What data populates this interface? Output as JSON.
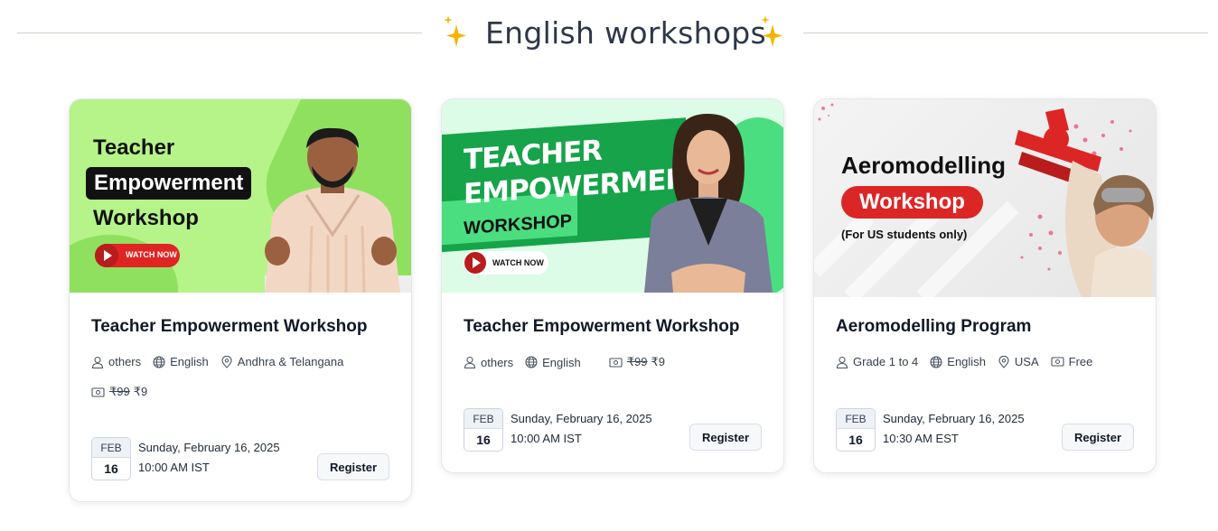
{
  "section": {
    "title": "English workshops"
  },
  "colors": {
    "accent": "#f5b400",
    "thumb1_bg": "#b9f58c",
    "thumb2_bg": "#dcfce7",
    "thumb2_band": "#16a34a",
    "thumb3_accent": "#dc2626"
  },
  "cards": [
    {
      "thumb": {
        "line1": "Teacher",
        "line2": "Empowerment",
        "line3": "Workshop",
        "cta": "WATCH NOW"
      },
      "title": "Teacher Empowerment Workshop",
      "audience": "others",
      "language": "English",
      "location": "Andhra & Telangana",
      "price_old": "₹99",
      "price_new": "₹9",
      "month": "FEB",
      "day": "16",
      "date": "Sunday, February 16, 2025",
      "time": "10:00 AM IST",
      "button": "Register"
    },
    {
      "thumb": {
        "line1": "TEACHER",
        "line2": "EMPOWERMENT",
        "line3": "WORKSHOP",
        "cta": "WATCH NOW"
      },
      "title": "Teacher Empowerment Workshop",
      "audience": "others",
      "language": "English",
      "price_old": "₹99",
      "price_new": "₹9",
      "month": "FEB",
      "day": "16",
      "date": "Sunday, February 16, 2025",
      "time": "10:00 AM IST",
      "button": "Register"
    },
    {
      "thumb": {
        "line1": "Aeromodelling",
        "line2": "Workshop",
        "line3": "(For US students only)"
      },
      "title": "Aeromodelling Program",
      "audience": "Grade 1 to 4",
      "language": "English",
      "location": "USA",
      "price": "Free",
      "month": "FEB",
      "day": "16",
      "date": "Sunday, February 16, 2025",
      "time": "10:30 AM EST",
      "button": "Register"
    }
  ]
}
